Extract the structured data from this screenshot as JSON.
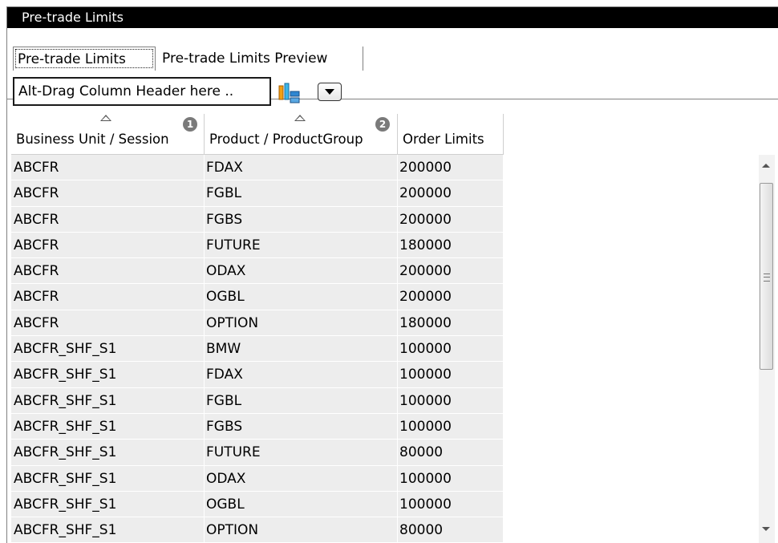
{
  "window": {
    "title": "Pre-trade Limits"
  },
  "tabs": [
    {
      "label": "Pre-trade Limits",
      "active": true
    },
    {
      "label": "Pre-trade Limits Preview",
      "active": false
    }
  ],
  "grouping": {
    "placeholder": "Alt-Drag Column Header here ..",
    "icon": "group-columns-icon",
    "dropdown_icon": "chevron-down-icon"
  },
  "table": {
    "columns": [
      {
        "label": "Business Unit / Session",
        "sort": "ascending",
        "sort_order": "1"
      },
      {
        "label": "Product / ProductGroup",
        "sort": "ascending",
        "sort_order": "2"
      },
      {
        "label": "Order Limits"
      }
    ],
    "rows": [
      [
        "ABCFR",
        "FDAX",
        "200000"
      ],
      [
        "ABCFR",
        "FGBL",
        "200000"
      ],
      [
        "ABCFR",
        "FGBS",
        "200000"
      ],
      [
        "ABCFR",
        "FUTURE",
        "180000"
      ],
      [
        "ABCFR",
        "ODAX",
        "200000"
      ],
      [
        "ABCFR",
        "OGBL",
        "200000"
      ],
      [
        "ABCFR",
        "OPTION",
        "180000"
      ],
      [
        "ABCFR_SHF_S1",
        "BMW",
        "100000"
      ],
      [
        "ABCFR_SHF_S1",
        "FDAX",
        "100000"
      ],
      [
        "ABCFR_SHF_S1",
        "FGBL",
        "100000"
      ],
      [
        "ABCFR_SHF_S1",
        "FGBS",
        "100000"
      ],
      [
        "ABCFR_SHF_S1",
        "FUTURE",
        "80000"
      ],
      [
        "ABCFR_SHF_S1",
        "ODAX",
        "100000"
      ],
      [
        "ABCFR_SHF_S1",
        "OGBL",
        "100000"
      ],
      [
        "ABCFR_SHF_S1",
        "OPTION",
        "80000"
      ]
    ]
  },
  "colors": {
    "title_bg": "#000000",
    "row_bg": "#ededed",
    "border": "#808080"
  }
}
